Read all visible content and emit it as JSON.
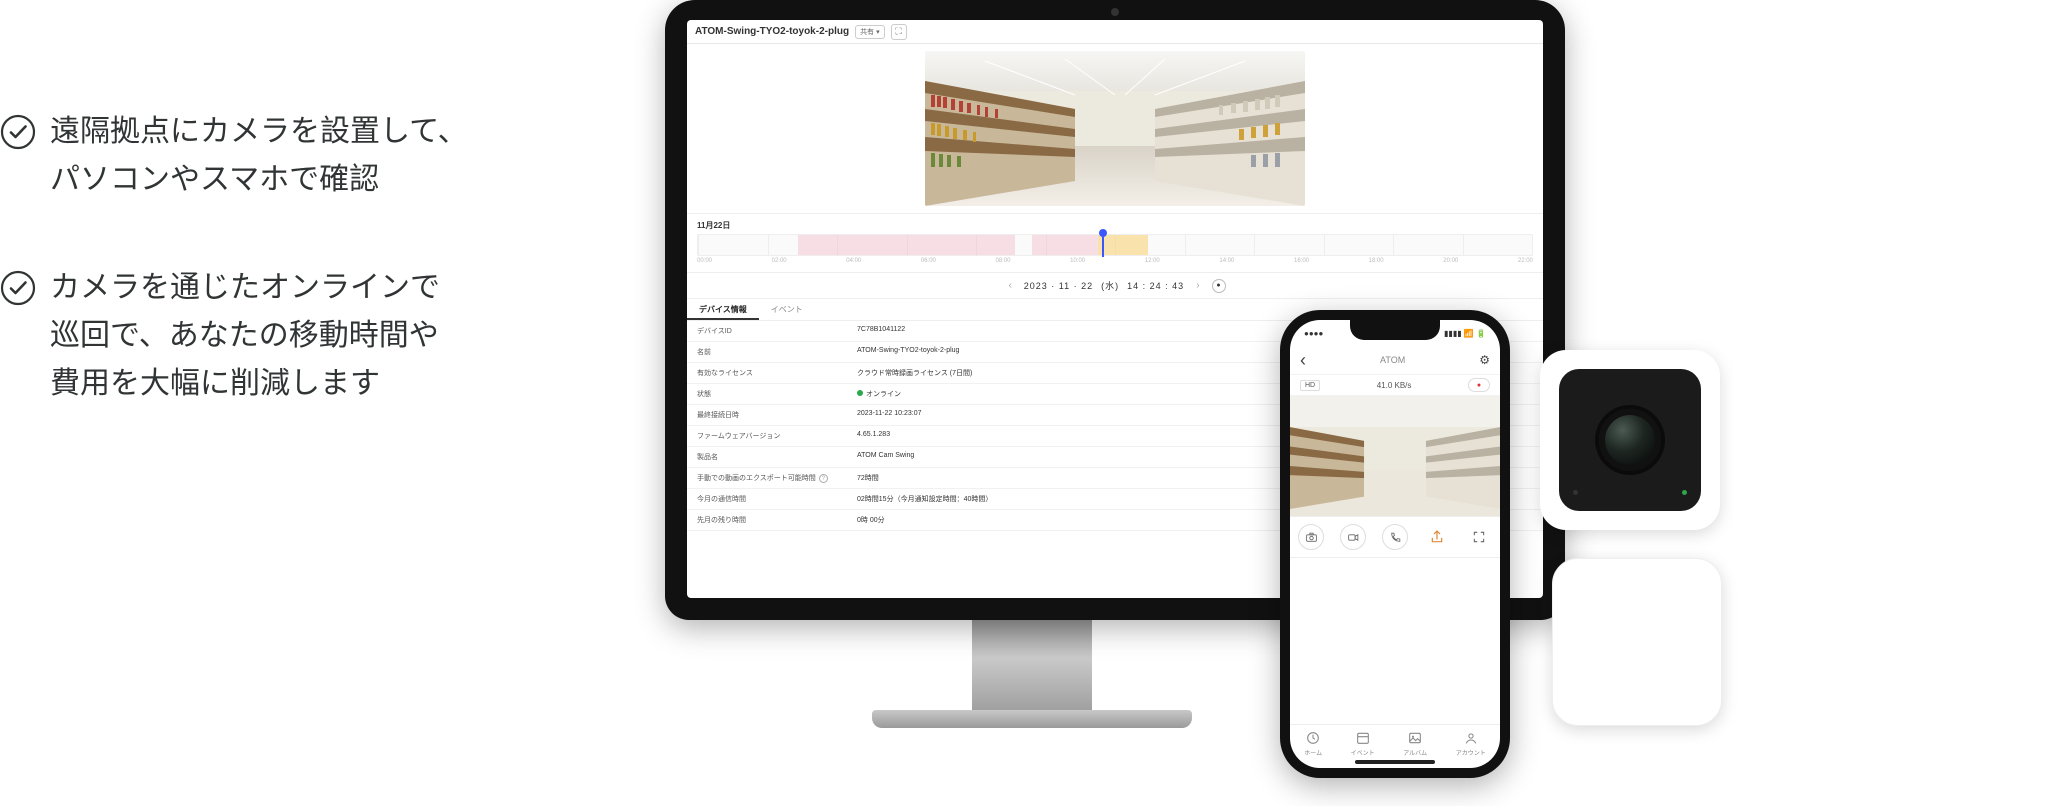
{
  "features": [
    "遠隔拠点にカメラを設置して、\nパソコンやスマホで確認",
    "カメラを通じたオンラインで\n巡回で、あなたの移動時間や\n費用を大幅に削減します"
  ],
  "desktop": {
    "title": "ATOM-Swing-TYO2-toyok-2-plug",
    "share_label": "共有",
    "chevron": "▾",
    "expand_icon": "⛶",
    "timeline": {
      "date_label": "11月22日",
      "hours": [
        "00:00",
        "02:00",
        "04:00",
        "06:00",
        "08:00",
        "10:00",
        "12:00",
        "14:00",
        "16:00",
        "18:00",
        "20:00",
        "22:00"
      ]
    },
    "datetime": {
      "prev": "‹",
      "date": "2023 · 11 · 22",
      "dow": "(水)",
      "time": "14 : 24 : 43",
      "next": "›",
      "live": "●"
    },
    "tabs": {
      "device_info": "デバイス情報",
      "events": "イベント"
    },
    "info": [
      {
        "label": "デバイスID",
        "value": "7C78B1041122"
      },
      {
        "label": "名前",
        "value": "ATOM-Swing-TYO2-toyok-2-plug"
      },
      {
        "label": "有効なライセンス",
        "value": "クラウド常時録画ライセンス (7日間)"
      },
      {
        "label": "状態",
        "value": "オンライン",
        "online": true
      },
      {
        "label": "最終接続日時",
        "value": "2023-11-22 10:23:07"
      },
      {
        "label": "ファームウェアバージョン",
        "value": "4.65.1.283"
      },
      {
        "label": "製品名",
        "value": "ATOM Cam Swing"
      },
      {
        "label": "手動での動画のエクスポート可能時間",
        "value": "72時間",
        "help": true
      },
      {
        "label": "今月の通信時間",
        "value": "02時間15分（今月通知設定時間：40時間）"
      },
      {
        "label": "先月の残り時間",
        "value": "0時 00分"
      }
    ]
  },
  "phone": {
    "status_left": "●●●●",
    "status_right": "▮▮▮▮ 📶 🔋",
    "back": "‹",
    "top_center": "ATOM",
    "settings": "⚙",
    "mode": "HD",
    "bitrate": "41.0 KB/s",
    "rec": "●",
    "actions": {
      "camera": "camera-icon",
      "video": "video-icon",
      "call": "call-icon",
      "share": "share-icon",
      "expand": "expand-icon"
    },
    "bottom": {
      "home": "ホーム",
      "events": "イベント",
      "album": "アルバム",
      "account": "アカウント"
    }
  }
}
